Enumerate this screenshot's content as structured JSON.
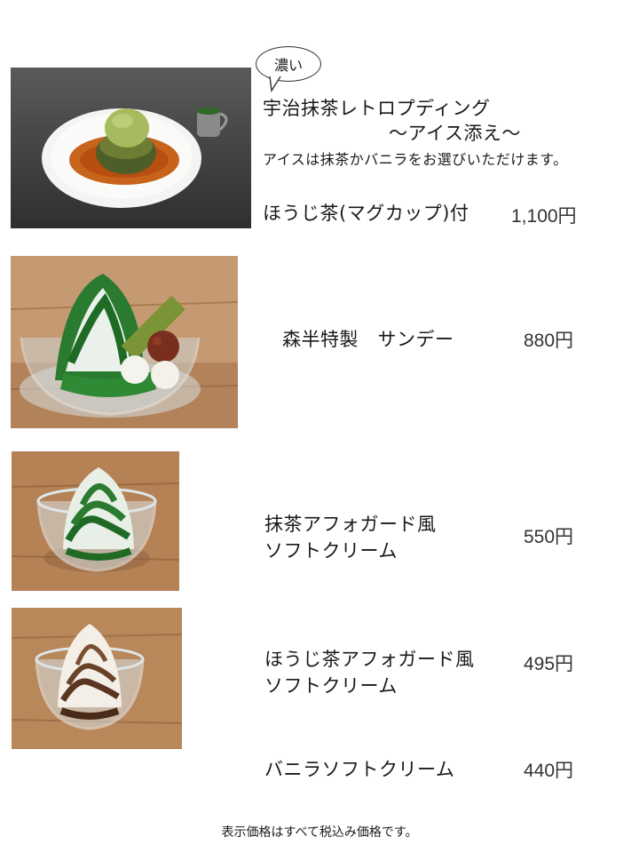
{
  "bubble": {
    "label": "濃い"
  },
  "items": [
    {
      "title_line1": "宇治抹茶レトロプディング",
      "title_line2": "～アイス添え～",
      "note": "アイスは抹茶かバニラをお選びいただけます。",
      "extra": "ほうじ茶(マグカップ)付",
      "price": "1,100円"
    },
    {
      "title": "森半特製　サンデー",
      "price": "880円"
    },
    {
      "title_line1": "抹茶アフォガード風",
      "title_line2": "ソフトクリーム",
      "price": "550円"
    },
    {
      "title_line1": "ほうじ茶アフォガード風",
      "title_line2": "ソフトクリーム",
      "price": "495円"
    },
    {
      "title": "バニラソフトクリーム",
      "price": "440円"
    }
  ],
  "footer": {
    "note": "表示価格はすべて税込み価格です。"
  },
  "photos": [
    {
      "icon": "matcha-pudding-photo"
    },
    {
      "icon": "matcha-sundae-photo"
    },
    {
      "icon": "matcha-affogato-soft-cream-photo"
    },
    {
      "icon": "hojicha-affogato-soft-cream-photo"
    }
  ],
  "colors": {
    "matcha": "#2f7a2a",
    "wood": "#b9875a",
    "caramel": "#c8631c",
    "hojicha": "#5a3520"
  }
}
